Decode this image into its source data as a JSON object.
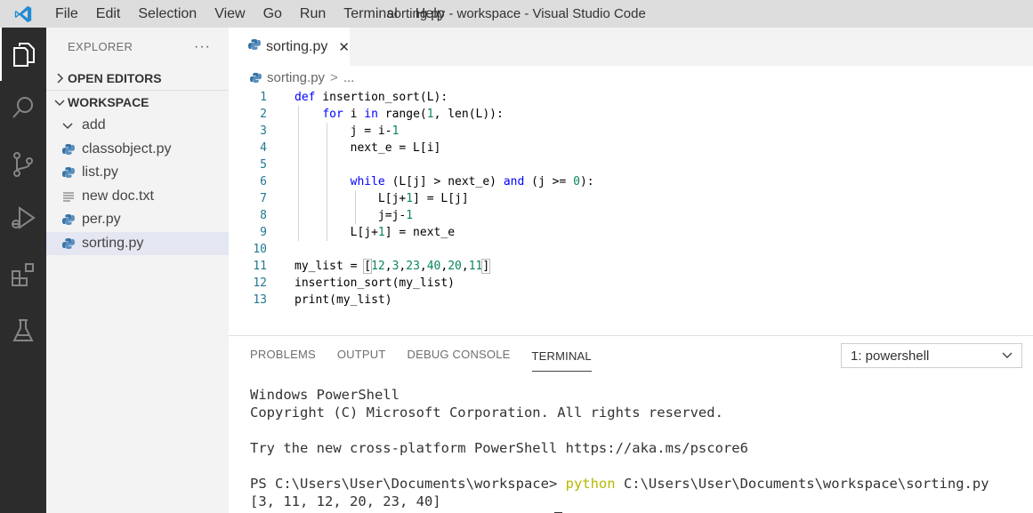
{
  "titlebar": {
    "menu": [
      "File",
      "Edit",
      "Selection",
      "View",
      "Go",
      "Run",
      "Terminal",
      "Help"
    ],
    "window_title": "sorting.py - workspace - Visual Studio Code",
    "logo_color": "#1f8ad2"
  },
  "activitybar": {
    "icons": [
      "explorer-icon",
      "search-icon",
      "source-control-icon",
      "run-debug-icon",
      "extensions-icon",
      "testing-icon"
    ]
  },
  "sidebar": {
    "title": "EXPLORER",
    "more": "···",
    "sections": {
      "open_editors": "OPEN EDITORS",
      "workspace": "WORKSPACE"
    },
    "items": [
      {
        "label": "add",
        "icon": "chevron-down-icon"
      },
      {
        "label": "classobject.py",
        "icon": "python-icon"
      },
      {
        "label": "list.py",
        "icon": "python-icon"
      },
      {
        "label": "new doc.txt",
        "icon": "text-file-icon"
      },
      {
        "label": "per.py",
        "icon": "python-icon"
      },
      {
        "label": "sorting.py",
        "icon": "python-icon"
      }
    ]
  },
  "editor": {
    "tab": {
      "label": "sorting.py",
      "close": "✕"
    },
    "breadcrumb": {
      "file": "sorting.py",
      "sep": ">",
      "rest": "..."
    },
    "line_numbers": [
      "1",
      "2",
      "3",
      "4",
      "5",
      "6",
      "7",
      "8",
      "9",
      "10",
      "11",
      "12",
      "13"
    ]
  },
  "panel": {
    "tabs": [
      "PROBLEMS",
      "OUTPUT",
      "DEBUG CONSOLE",
      "TERMINAL"
    ],
    "active_tab": "TERMINAL",
    "terminal_select": "1: powershell",
    "terminal": {
      "line1": "Windows PowerShell",
      "line2": "Copyright (C) Microsoft Corporation. All rights reserved.",
      "line3": "Try the new cross-platform PowerShell https://aka.ms/pscore6",
      "prompt": "PS C:\\Users\\User\\Documents\\workspace> ",
      "cmd": "python",
      "args": " C:\\Users\\User\\Documents\\workspace\\sorting.py",
      "output": "[3, 11, 12, 20, 23, 40]"
    }
  },
  "colors": {
    "keyword": "#0000ff",
    "number": "#098658",
    "line_number": "#237893",
    "activity_bar": "#2c2c2c"
  }
}
